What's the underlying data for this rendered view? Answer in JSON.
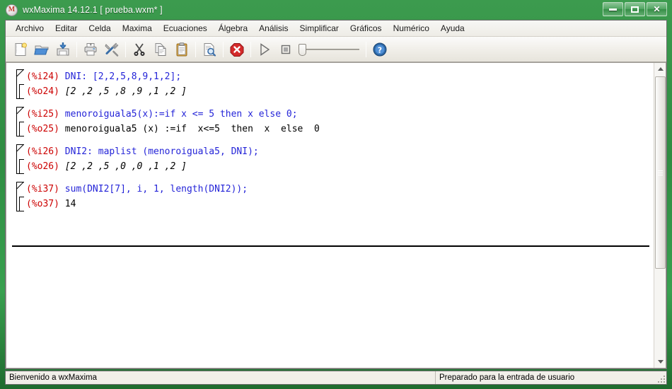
{
  "window": {
    "app_icon": "maxima-logo-icon",
    "title": "wxMaxima 14.12.1  [ prueba.wxm* ]",
    "buttons": {
      "minimize": "minimize-icon",
      "maximize": "maximize-icon",
      "close": "✕"
    }
  },
  "menubar": {
    "items": [
      {
        "label": "Archivo"
      },
      {
        "label": "Editar"
      },
      {
        "label": "Celda"
      },
      {
        "label": "Maxima"
      },
      {
        "label": "Ecuaciones"
      },
      {
        "label": "Álgebra"
      },
      {
        "label": "Análisis"
      },
      {
        "label": "Simplificar"
      },
      {
        "label": "Gráficos"
      },
      {
        "label": "Numérico"
      },
      {
        "label": "Ayuda"
      }
    ]
  },
  "toolbar": {
    "buttons": [
      {
        "name": "new-document-icon"
      },
      {
        "name": "open-folder-icon"
      },
      {
        "name": "save-icon"
      },
      {
        "name": "print-icon"
      },
      {
        "name": "preferences-tools-icon"
      },
      {
        "name": "cut-scissors-icon"
      },
      {
        "name": "copy-icon"
      },
      {
        "name": "paste-clipboard-icon"
      },
      {
        "name": "find-replace-icon"
      },
      {
        "name": "stop-interrupt-icon"
      },
      {
        "name": "play-evaluate-icon"
      },
      {
        "name": "stop-square-icon"
      },
      {
        "name": "animation-slider"
      },
      {
        "name": "help-icon"
      }
    ]
  },
  "worksheet": {
    "cells": [
      {
        "input_prompt": "(%i24)",
        "input_text": "DNI: [2,2,5,8,9,1,2];",
        "output_prompt": "(%o24)",
        "output_text": "[2 ,2 ,5 ,8 ,9 ,1 ,2 ]"
      },
      {
        "input_prompt": "(%i25)",
        "input_text": "menoroiguala5(x):=if x <= 5 then x else 0;",
        "output_prompt": "(%o25)",
        "output_text": "menoroiguala5 (x) :=if  x<=5  then  x  else  0"
      },
      {
        "input_prompt": "(%i26)",
        "input_text": "DNI2: maplist (menoroiguala5, DNI);",
        "output_prompt": "(%o26)",
        "output_text": "[2 ,2 ,5 ,0 ,0 ,1 ,2 ]"
      },
      {
        "input_prompt": "(%i37)",
        "input_text": "sum(DNI2[7], i, 1, length(DNI2));",
        "output_prompt": "(%o37)",
        "output_text": "14"
      }
    ]
  },
  "statusbar": {
    "left": "Bienvenido a wxMaxima",
    "right": "Preparado para la entrada de usuario"
  },
  "colors": {
    "prompt": "#cc0000",
    "input": "#2424d8",
    "output": "#000000",
    "titlebar": "#3c9b4e"
  }
}
